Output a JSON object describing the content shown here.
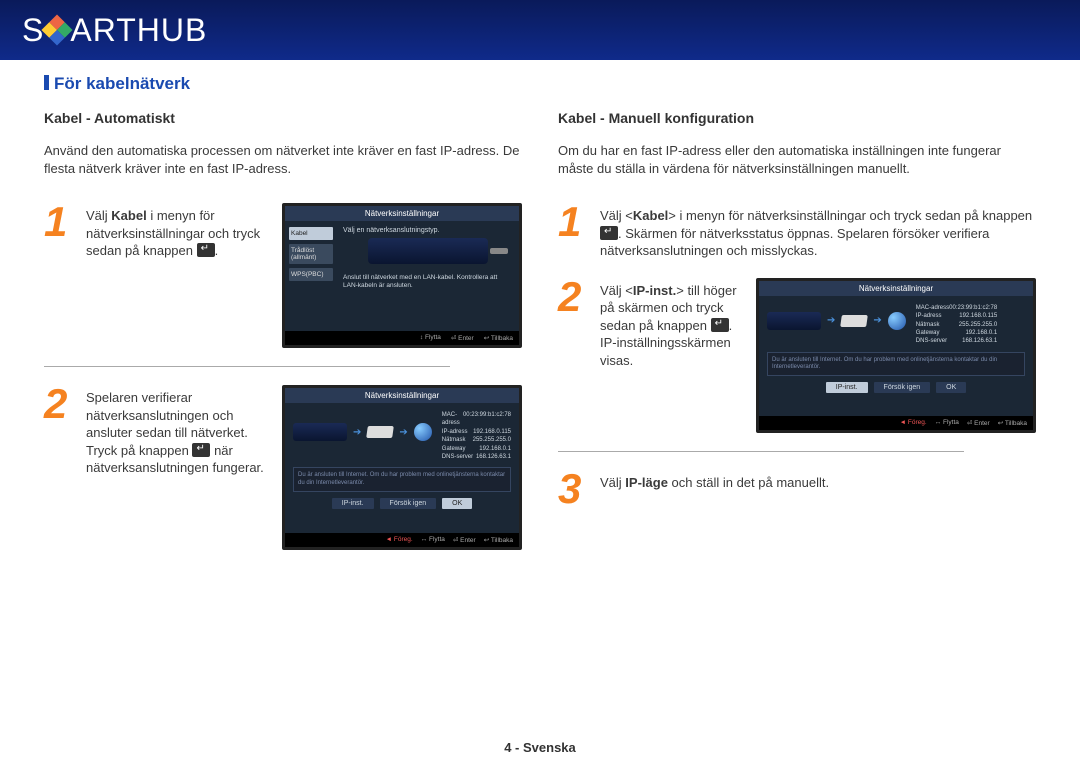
{
  "logo": {
    "part1": "S",
    "part2": "ART",
    "part3": " HUB"
  },
  "sectionTitle": "För kabelnätverk",
  "left": {
    "subhead": "Kabel - Automatiskt",
    "intro": "Använd den automatiska processen om nätverket inte kräver en fast IP-adress. De flesta nätverk kräver inte en fast IP-adress.",
    "steps": [
      {
        "num": "1",
        "text_a": "Välj ",
        "bold1": "Kabel",
        "text_b": " i menyn för nätverksinställningar och tryck sedan på knappen ",
        "icon": true,
        "text_c": "."
      },
      {
        "num": "2",
        "text_a": "Spelaren verifierar nätverksanslutningen och ansluter sedan till nätverket.",
        "text_b": "Tryck på knappen ",
        "icon": true,
        "text_c": " när nätverksanslutningen fungerar."
      }
    ]
  },
  "right": {
    "subhead": "Kabel - Manuell konfiguration",
    "intro": "Om du har en fast IP-adress eller den automatiska inställningen inte fungerar måste du ställa in värdena för nätverksinställningen manuellt.",
    "steps": [
      {
        "num": "1",
        "text_a": "Välj <",
        "bold1": "Kabel",
        "text_b": "> i menyn för nätverksinställningar och tryck sedan på knappen ",
        "icon": true,
        "text_c": ". Skärmen för nätverksstatus öppnas. Spelaren försöker verifiera nätverksanslutningen och misslyckas."
      },
      {
        "num": "2",
        "text_a": "Välj <",
        "bold1": "IP-inst.",
        "text_b": "> till höger på skärmen och tryck sedan på knappen ",
        "icon": true,
        "text_c": ". IP-inställningsskärmen visas."
      },
      {
        "num": "3",
        "text_a": "Välj ",
        "bold1": "IP-läge",
        "text_b": " och ställ in det på manuellt."
      }
    ]
  },
  "screenshot": {
    "title": "Nätverksinställningar",
    "pick": "Välj en nätverksanslutningstyp.",
    "tabs": {
      "kabel": "Kabel",
      "wifi": "Trådlöst\n(allmänt)",
      "wps": "WPS(PBC)"
    },
    "note": "Anslut till nätverket med en LAN-kabel. Kontrollera att LAN-kabeln är ansluten.",
    "foot": {
      "move": "Flytta",
      "enter": "Enter",
      "back": "Tillbaka"
    },
    "net": {
      "mac_l": "MAC-adress",
      "mac_v": "00:23:99:b1:c2:78",
      "ip_l": "IP-adress",
      "ip_v": "192.168.0.115",
      "mask_l": "Nätmask",
      "mask_v": "255.255.255.0",
      "gw_l": "Gateway",
      "gw_v": "192.168.0.1",
      "dns_l": "DNS-server",
      "dns_v": "168.126.63.1"
    },
    "msg": "Du är ansluten till Internet. Om du har problem med onlinetjänsterna kontaktar du din Internetleverantör.",
    "btns": {
      "ipinst": "IP-inst.",
      "retry": "Försök igen",
      "ok": "OK"
    },
    "foot2": {
      "prev": "Föreg.",
      "move": "Flytta",
      "enter": "Enter",
      "back": "Tillbaka"
    }
  },
  "footer": "4 - Svenska"
}
